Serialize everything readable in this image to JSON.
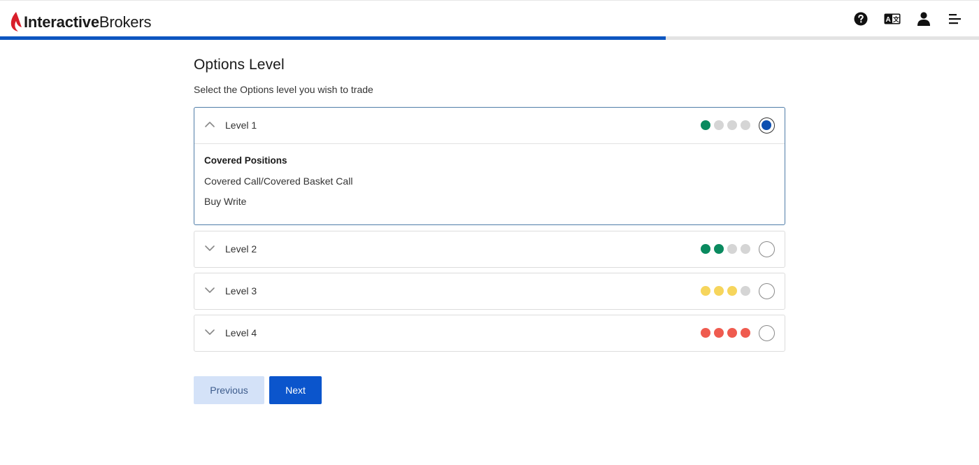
{
  "header": {
    "logo": {
      "bold": "Interactive",
      "light": "Brokers"
    },
    "icons": [
      "help-icon",
      "language-icon",
      "user-icon",
      "menu-icon"
    ],
    "language_icon_text": "A文"
  },
  "progress": {
    "percent": 68
  },
  "page": {
    "title": "Options Level",
    "subtitle": "Select the Options level you wish to trade"
  },
  "levels": [
    {
      "label": "Level 1",
      "expanded": true,
      "selected": true,
      "dots": [
        "#0a8a5f",
        "#d5d5d5",
        "#d5d5d5",
        "#d5d5d5"
      ],
      "details": {
        "heading": "Covered Positions",
        "items": [
          "Covered Call/Covered Basket Call",
          "Buy Write"
        ]
      }
    },
    {
      "label": "Level 2",
      "expanded": false,
      "selected": false,
      "dots": [
        "#0a8a5f",
        "#0a8a5f",
        "#d5d5d5",
        "#d5d5d5"
      ]
    },
    {
      "label": "Level 3",
      "expanded": false,
      "selected": false,
      "dots": [
        "#f6d55c",
        "#f6d55c",
        "#f6d55c",
        "#d5d5d5"
      ]
    },
    {
      "label": "Level 4",
      "expanded": false,
      "selected": false,
      "dots": [
        "#ef5b4f",
        "#ef5b4f",
        "#ef5b4f",
        "#ef5b4f"
      ]
    }
  ],
  "buttons": {
    "previous": "Previous",
    "next": "Next"
  },
  "colors": {
    "brand_red": "#d81e2a",
    "primary_blue": "#0b55cc",
    "progress_blue": "#0d56c0"
  }
}
